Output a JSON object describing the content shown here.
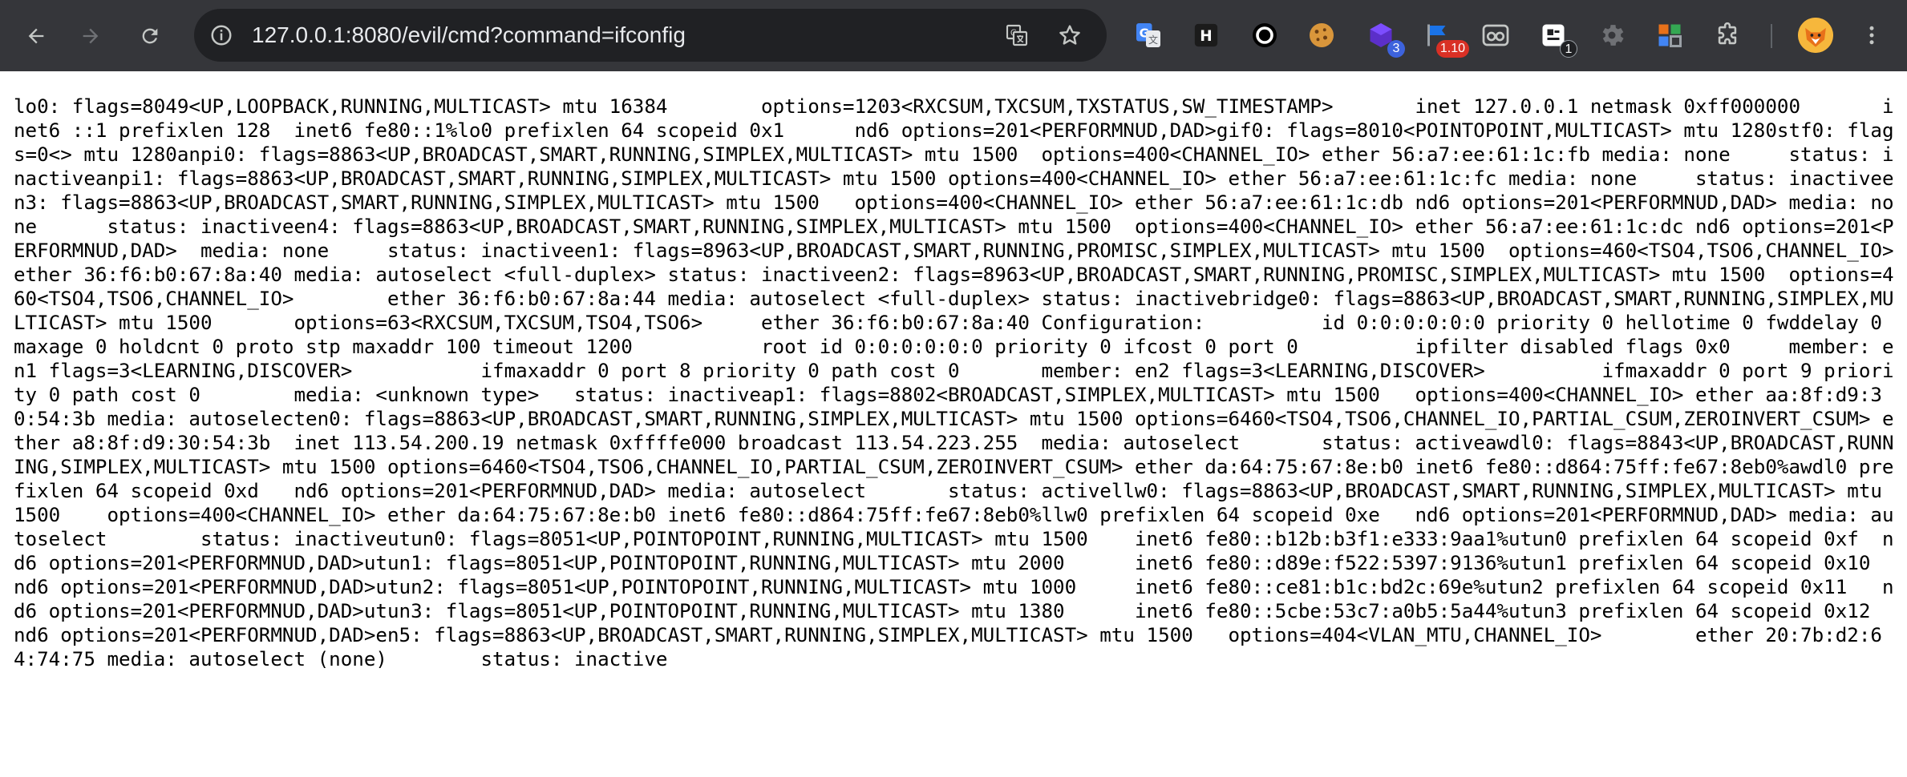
{
  "browser": {
    "url": "127.0.0.1:8080/evil/cmd?command=ifconfig",
    "extensions": [
      {
        "name": "google-translate-ext-icon",
        "badge": ""
      },
      {
        "name": "h-ext-icon",
        "badge": ""
      },
      {
        "name": "circle-ext-icon",
        "badge": ""
      },
      {
        "name": "cookie-ext-icon",
        "badge": ""
      },
      {
        "name": "cube-ext-icon",
        "badge": "3"
      },
      {
        "name": "flag-ext-icon",
        "badge": "1.10"
      },
      {
        "name": "glasses-ext-icon",
        "badge": ""
      },
      {
        "name": "clipboard-ext-icon",
        "badge": "1"
      },
      {
        "name": "gear-ext-icon",
        "badge": ""
      },
      {
        "name": "grid-ext-icon",
        "badge": ""
      },
      {
        "name": "puzzle-icon",
        "badge": ""
      }
    ],
    "colors": {
      "toolbar": "#35363a",
      "omnibox": "#202124",
      "badge_blue": "#3d63dd",
      "badge_red": "#d93025",
      "badge_dark": "#202124"
    }
  },
  "page": {
    "output": "lo0: flags=8049<UP,LOOPBACK,RUNNING,MULTICAST> mtu 16384\toptions=1203<RXCSUM,TXCSUM,TXSTATUS,SW_TIMESTAMP>\tinet 127.0.0.1 netmask 0xff000000\tinet6 ::1 prefixlen 128 \tinet6 fe80::1%lo0 prefixlen 64 scopeid 0x1 \tnd6 options=201<PERFORMNUD,DAD>gif0: flags=8010<POINTOPOINT,MULTICAST> mtu 1280stf0: flags=0<> mtu 1280anpi0: flags=8863<UP,BROADCAST,SMART,RUNNING,SIMPLEX,MULTICAST> mtu 1500\toptions=400<CHANNEL_IO>\tether 56:a7:ee:61:1c:fb\tmedia: none\tstatus: inactiveanpi1: flags=8863<UP,BROADCAST,SMART,RUNNING,SIMPLEX,MULTICAST> mtu 1500\toptions=400<CHANNEL_IO>\tether 56:a7:ee:61:1c:fc\tmedia: none\tstatus: inactiveen3: flags=8863<UP,BROADCAST,SMART,RUNNING,SIMPLEX,MULTICAST> mtu 1500\toptions=400<CHANNEL_IO>\tether 56:a7:ee:61:1c:db\tnd6 options=201<PERFORMNUD,DAD>\tmedia: none\tstatus: inactiveen4: flags=8863<UP,BROADCAST,SMART,RUNNING,SIMPLEX,MULTICAST> mtu 1500\toptions=400<CHANNEL_IO>\tether 56:a7:ee:61:1c:dc\tnd6 options=201<PERFORMNUD,DAD>\tmedia: none\tstatus: inactiveen1: flags=8963<UP,BROADCAST,SMART,RUNNING,PROMISC,SIMPLEX,MULTICAST> mtu 1500\toptions=460<TSO4,TSO6,CHANNEL_IO>\tether 36:f6:b0:67:8a:40\tmedia: autoselect <full-duplex>\tstatus: inactiveen2: flags=8963<UP,BROADCAST,SMART,RUNNING,PROMISC,SIMPLEX,MULTICAST> mtu 1500\toptions=460<TSO4,TSO6,CHANNEL_IO>\tether 36:f6:b0:67:8a:44\tmedia: autoselect <full-duplex>\tstatus: inactivebridge0: flags=8863<UP,BROADCAST,SMART,RUNNING,SIMPLEX,MULTICAST> mtu 1500\toptions=63<RXCSUM,TXCSUM,TSO4,TSO6>\tether 36:f6:b0:67:8a:40\tConfiguration:\t\tid 0:0:0:0:0:0 priority 0 hellotime 0 fwddelay 0\t\tmaxage 0 holdcnt 0 proto stp maxaddr 100 timeout 1200\t\troot id 0:0:0:0:0:0 priority 0 ifcost 0 port 0\t\tipfilter disabled flags 0x0\tmember: en1 flags=3<LEARNING,DISCOVER>\t        ifmaxaddr 0 port 8 priority 0 path cost 0\tmember: en2 flags=3<LEARNING,DISCOVER>\t        ifmaxaddr 0 port 9 priority 0 path cost 0\tmedia: <unknown type>\tstatus: inactiveap1: flags=8802<BROADCAST,SIMPLEX,MULTICAST> mtu 1500\toptions=400<CHANNEL_IO>\tether aa:8f:d9:30:54:3b\tmedia: autoselecten0: flags=8863<UP,BROADCAST,SMART,RUNNING,SIMPLEX,MULTICAST> mtu 1500\toptions=6460<TSO4,TSO6,CHANNEL_IO,PARTIAL_CSUM,ZEROINVERT_CSUM>\tether a8:8f:d9:30:54:3b\tinet 113.54.200.19 netmask 0xffffe000 broadcast 113.54.223.255\tmedia: autoselect\tstatus: activeawdl0: flags=8843<UP,BROADCAST,RUNNING,SIMPLEX,MULTICAST> mtu 1500\toptions=6460<TSO4,TSO6,CHANNEL_IO,PARTIAL_CSUM,ZEROINVERT_CSUM>\tether da:64:75:67:8e:b0\tinet6 fe80::d864:75ff:fe67:8eb0%awdl0 prefixlen 64 scopeid 0xd \tnd6 options=201<PERFORMNUD,DAD>\tmedia: autoselect\tstatus: activellw0: flags=8863<UP,BROADCAST,SMART,RUNNING,SIMPLEX,MULTICAST> mtu 1500\toptions=400<CHANNEL_IO>\tether da:64:75:67:8e:b0\tinet6 fe80::d864:75ff:fe67:8eb0%llw0 prefixlen 64 scopeid 0xe \tnd6 options=201<PERFORMNUD,DAD>\tmedia: autoselect\tstatus: inactiveutun0: flags=8051<UP,POINTOPOINT,RUNNING,MULTICAST> mtu 1500\tinet6 fe80::b12b:b3f1:e333:9aa1%utun0 prefixlen 64 scopeid 0xf \tnd6 options=201<PERFORMNUD,DAD>utun1: flags=8051<UP,POINTOPOINT,RUNNING,MULTICAST> mtu 2000\tinet6 fe80::d89e:f522:5397:9136%utun1 prefixlen 64 scopeid 0x10 \tnd6 options=201<PERFORMNUD,DAD>utun2: flags=8051<UP,POINTOPOINT,RUNNING,MULTICAST> mtu 1000\tinet6 fe80::ce81:b1c:bd2c:69e%utun2 prefixlen 64 scopeid 0x11 \tnd6 options=201<PERFORMNUD,DAD>utun3: flags=8051<UP,POINTOPOINT,RUNNING,MULTICAST> mtu 1380\tinet6 fe80::5cbe:53c7:a0b5:5a44%utun3 prefixlen 64 scopeid 0x12 \tnd6 options=201<PERFORMNUD,DAD>en5: flags=8863<UP,BROADCAST,SMART,RUNNING,SIMPLEX,MULTICAST> mtu 1500\toptions=404<VLAN_MTU,CHANNEL_IO>\tether 20:7b:d2:64:74:75\tmedia: autoselect (none)\tstatus: inactive"
  }
}
